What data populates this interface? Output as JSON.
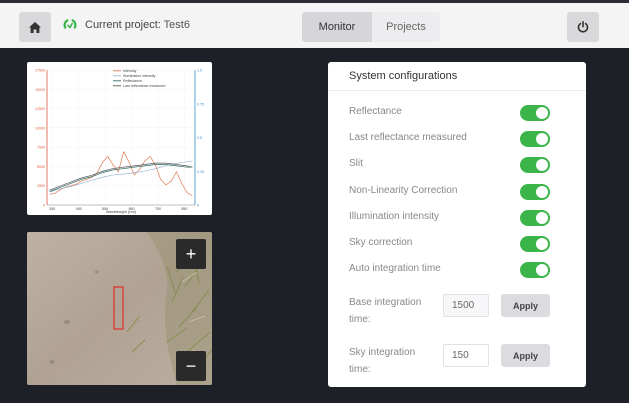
{
  "header": {
    "project_prefix": "Current project:",
    "project_name": "Test6",
    "tabs": [
      {
        "label": "Monitor",
        "active": true
      },
      {
        "label": "Projects",
        "active": false
      }
    ],
    "icons": {
      "home": "home-icon",
      "project": "project-status-icon",
      "power": "power-icon"
    }
  },
  "chart_data": {
    "type": "line",
    "xlabel": "Wavelength (nm)",
    "x_ticks": [
      "350",
      "450",
      "550",
      "650",
      "750",
      "850"
    ],
    "y_left_ticks": [
      "17500",
      "15000",
      "12500",
      "10000",
      "7500",
      "5000",
      "2500",
      "0"
    ],
    "y_right_ticks": [
      "1.0",
      "0.75",
      "0.5",
      "0.25",
      "0"
    ],
    "ylim_left": [
      0,
      17500
    ],
    "ylim_right": [
      0,
      1.0
    ],
    "legend_position": "top-right",
    "grid": true,
    "series": [
      {
        "name": "Intensity",
        "color": "#e07b53",
        "axis": "left",
        "x": [
          340,
          360,
          380,
          400,
          420,
          440,
          460,
          480,
          500,
          520,
          540,
          560,
          580,
          600,
          620,
          640,
          660,
          680,
          700,
          720,
          740,
          760,
          780,
          800,
          820,
          840,
          860,
          880
        ],
        "y": [
          1400,
          1500,
          2000,
          2300,
          2500,
          2700,
          3100,
          3300,
          3600,
          4200,
          5500,
          6300,
          5200,
          4300,
          6900,
          5600,
          3900,
          4600,
          5700,
          6300,
          5200,
          3300,
          2600,
          3100,
          4300,
          2800,
          1600,
          1200
        ]
      },
      {
        "name": "Illumination intensity",
        "color": "#9bb7d4",
        "axis": "left",
        "x": [
          340,
          380,
          420,
          460,
          500,
          540,
          580,
          620,
          660,
          700,
          740,
          780,
          820,
          860,
          880
        ],
        "y": [
          1700,
          2100,
          2400,
          2800,
          3200,
          3600,
          3900,
          4000,
          4200,
          4400,
          4700,
          5100,
          5400,
          5600,
          5700
        ]
      },
      {
        "name": "Reflectance",
        "color": "#2e6b66",
        "axis": "right",
        "x": [
          340,
          380,
          420,
          460,
          500,
          540,
          580,
          620,
          660,
          700,
          740,
          780,
          820,
          860,
          880
        ],
        "y": [
          0.1,
          0.13,
          0.16,
          0.19,
          0.21,
          0.24,
          0.26,
          0.27,
          0.28,
          0.29,
          0.3,
          0.3,
          0.29,
          0.28,
          0.28
        ]
      },
      {
        "name": "Last reflectance measured",
        "color": "#555555",
        "axis": "right",
        "x": [
          340,
          380,
          420,
          460,
          500,
          540,
          580,
          620,
          660,
          700,
          740,
          780,
          820,
          860,
          880
        ],
        "y": [
          0.11,
          0.14,
          0.17,
          0.2,
          0.22,
          0.25,
          0.27,
          0.28,
          0.29,
          0.3,
          0.31,
          0.31,
          0.3,
          0.29,
          0.28
        ]
      }
    ]
  },
  "camera": {
    "zoom_in_label": "+",
    "zoom_out_label": "−",
    "slit_marker_color": "#e0302a"
  },
  "config": {
    "title": "System configurations",
    "toggles": [
      {
        "label": "Reflectance",
        "on": true
      },
      {
        "label": "Last reflectance measured",
        "on": true
      },
      {
        "label": "Slit",
        "on": true
      },
      {
        "label": "Non-Linearity Correction",
        "on": true
      },
      {
        "label": "Illumination intensity",
        "on": true
      },
      {
        "label": "Sky correction",
        "on": true
      },
      {
        "label": "Auto integration time",
        "on": true
      }
    ],
    "fields": [
      {
        "label": "Base integration time:",
        "value": "1500",
        "apply_label": "Apply"
      },
      {
        "label": "Sky integration time:",
        "value": "150",
        "apply_label": "Apply"
      }
    ],
    "accent_color": "#3bb54a"
  }
}
